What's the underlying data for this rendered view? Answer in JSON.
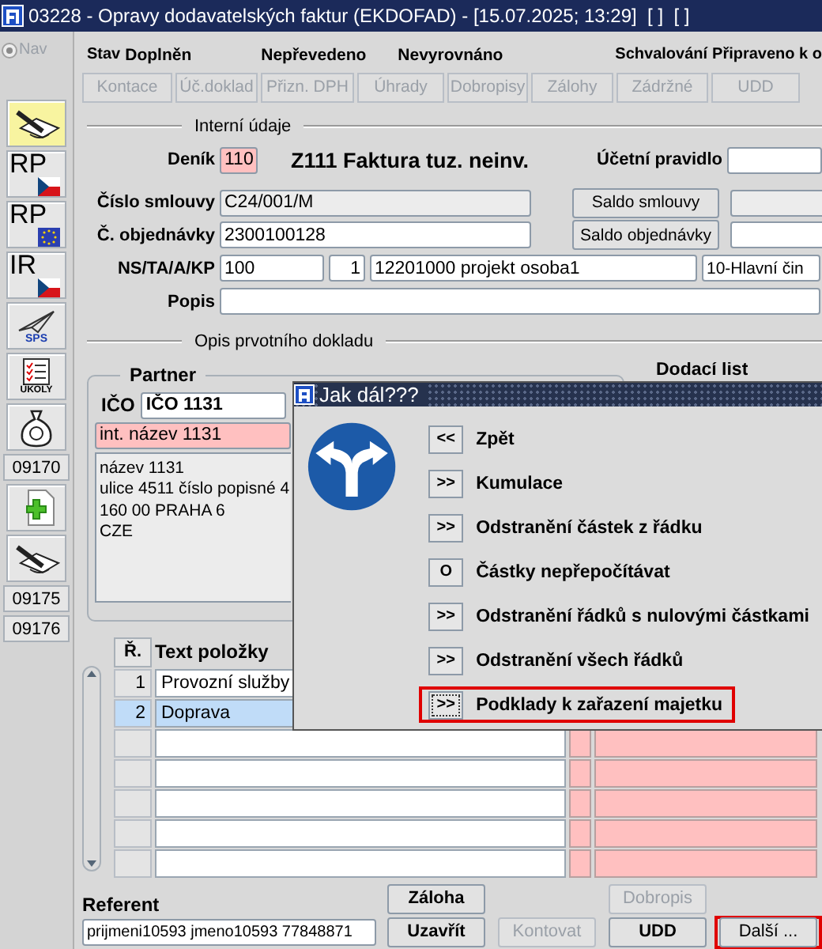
{
  "window": {
    "title": "03228 - Opravy dodavatelských faktur (EKDOFAD) - [15.07.2025; 13:29]  [ ]  [ ]"
  },
  "nav": {
    "label": "Nav",
    "selected": true
  },
  "toolbar": [
    {
      "kind": "pen"
    },
    {
      "kind": "czflag",
      "label": "RP"
    },
    {
      "kind": "euflag",
      "label": "RP"
    },
    {
      "kind": "czflag",
      "label": "IR"
    },
    {
      "kind": "plane",
      "label": "SPS"
    },
    {
      "kind": "checklist",
      "label": "ÚKOLY"
    },
    {
      "kind": "moneybag"
    },
    {
      "kind": "button",
      "label": "09170"
    },
    {
      "kind": "newdoc"
    },
    {
      "kind": "pen"
    },
    {
      "kind": "button",
      "label": "09175"
    },
    {
      "kind": "button",
      "label": "09176"
    }
  ],
  "status": {
    "label": "Stav",
    "values": [
      "Doplněn",
      "Nepřevedeno",
      "Nevyrovnáno"
    ],
    "approval_label": "Schvalování",
    "approval": "Připraveno k o"
  },
  "tabs": [
    {
      "label": "Kontace",
      "disabled": true
    },
    {
      "label": "Úč.doklad",
      "disabled": true
    },
    {
      "label": "Přizn. DPH",
      "disabled": true
    },
    {
      "label": "Úhrady",
      "disabled": true
    },
    {
      "label": "Dobropisy",
      "disabled": true
    },
    {
      "label": "Zálohy",
      "disabled": true
    },
    {
      "label": "Zádržné",
      "disabled": true
    },
    {
      "label": "UDD",
      "disabled": true
    }
  ],
  "internal": {
    "title": "Interní údaje",
    "journal": {
      "label": "Deník",
      "value": "110",
      "name": "Z111 Faktura tuz. neinv."
    },
    "rule": {
      "label": "Účetní pravidlo"
    },
    "contract": {
      "label": "Číslo smlouvy",
      "value": "C24/001/M",
      "button": "Saldo smlouvy"
    },
    "order": {
      "label": "Č. objednávky",
      "value": "2300100128",
      "button": "Saldo objednávky"
    },
    "codes": {
      "label": "NS/TA/A/KP",
      "values": [
        "100",
        "1",
        "12201000 projekt osoba1",
        "10-Hlavní čin"
      ]
    },
    "description": {
      "label": "Popis"
    }
  },
  "document": {
    "title": "Opis prvotního dokladu",
    "partner": {
      "title": "Partner",
      "id_label": "IČO",
      "id": "IČO 1131",
      "internal_name": "int. název 1131",
      "address": [
        "název 1131",
        "ulice 4511 číslo popisné 4",
        "160 00 PRAHA 6",
        "CZE"
      ]
    },
    "delivery": {
      "label": "Dodací list"
    }
  },
  "items": {
    "columns": [
      "Ř.",
      "Text položky"
    ],
    "rows": [
      {
        "number": "1",
        "text": "Provozní služby",
        "selected": false
      },
      {
        "number": "2",
        "text": "Doprava",
        "selected": true
      },
      {
        "selected": false
      },
      {
        "selected": false
      },
      {
        "selected": false
      },
      {
        "selected": false
      },
      {
        "selected": false
      }
    ]
  },
  "referent": {
    "label": "Referent",
    "value": "prijmeni10593 jmeno10593 77848871"
  },
  "actions": [
    {
      "label": "Záloha",
      "disabled": false,
      "highlighted": false
    },
    {
      "label": "Dobropis",
      "disabled": true,
      "highlighted": false
    },
    {
      "label": "Uzavřít",
      "disabled": false,
      "highlighted": false
    },
    {
      "label": "Kontovat",
      "disabled": true,
      "highlighted": false
    },
    {
      "label": "UDD",
      "disabled": false,
      "highlighted": false
    },
    {
      "label": "Další ...",
      "disabled": false,
      "highlighted": true
    }
  ],
  "dialog": {
    "title": "Jak dál???",
    "options": [
      {
        "key": "<<",
        "label": "Zpět",
        "highlighted": false
      },
      {
        "key": ">>",
        "label": "Kumulace",
        "highlighted": false
      },
      {
        "key": ">>",
        "label": "Odstranění částek z řádku",
        "highlighted": false
      },
      {
        "key": "O",
        "label": "Částky nepřepočítávat",
        "highlighted": false
      },
      {
        "key": ">>",
        "label": "Odstranění řádků s nulovými částkami",
        "highlighted": false
      },
      {
        "key": ">>",
        "label": "Odstranění všech řádků",
        "highlighted": false
      },
      {
        "key": ">>",
        "label": "Podklady k zařazení majetku",
        "highlighted": true
      }
    ]
  }
}
